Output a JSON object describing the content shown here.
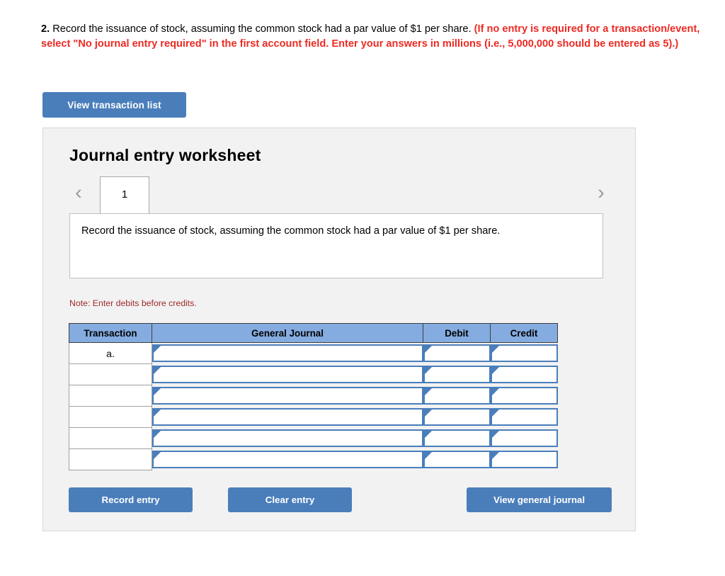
{
  "question": {
    "number": "2.",
    "prompt": " Record the issuance of stock, assuming the common stock had a par value of $1 per share. ",
    "instruction": "(If no entry is required for a transaction/event, select \"No journal entry required\" in the first account field. Enter your answers in millions (i.e., 5,000,000 should be entered as 5).)"
  },
  "toolbar": {
    "view_transaction_list_label": "View transaction list"
  },
  "worksheet": {
    "title": "Journal entry worksheet",
    "tabs": [
      {
        "label": "1"
      }
    ],
    "prev_chevron": "‹",
    "next_chevron": "›",
    "description": "Record the issuance of stock, assuming the common stock had a par value of $1 per share.",
    "note": "Note: Enter debits before credits."
  },
  "table": {
    "columns": [
      "Transaction",
      "General Journal",
      "Debit",
      "Credit"
    ],
    "rows": [
      {
        "transaction": "a.",
        "general_journal": "",
        "debit": "",
        "credit": ""
      },
      {
        "transaction": "",
        "general_journal": "",
        "debit": "",
        "credit": ""
      },
      {
        "transaction": "",
        "general_journal": "",
        "debit": "",
        "credit": ""
      },
      {
        "transaction": "",
        "general_journal": "",
        "debit": "",
        "credit": ""
      },
      {
        "transaction": "",
        "general_journal": "",
        "debit": "",
        "credit": ""
      },
      {
        "transaction": "",
        "general_journal": "",
        "debit": "",
        "credit": ""
      }
    ]
  },
  "actions": {
    "record_entry_label": "Record entry",
    "clear_entry_label": "Clear entry",
    "view_general_journal_label": "View general journal"
  },
  "colors": {
    "button_blue": "#4a7ebb",
    "header_blue": "#85ace0",
    "instruction_red": "#ed2a23",
    "note_red": "#9e2a2b",
    "panel_gray": "#f2f2f2"
  }
}
